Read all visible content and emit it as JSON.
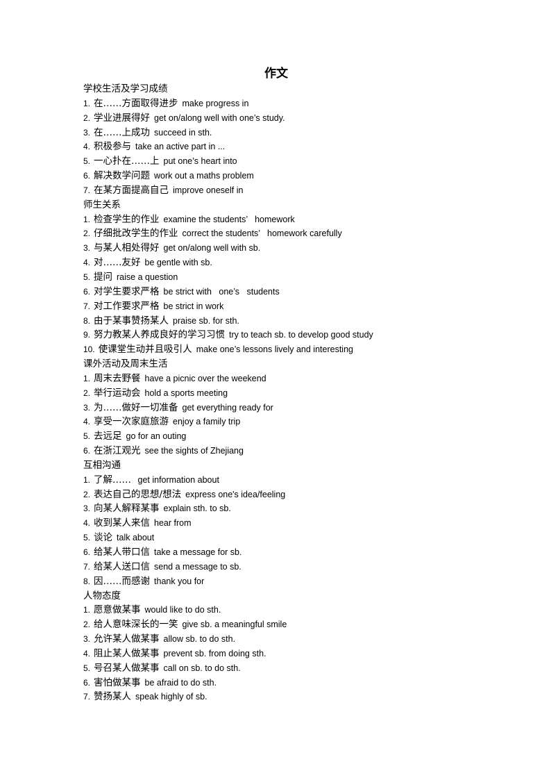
{
  "document": {
    "title": "作文",
    "sections": [
      {
        "heading": "学校生活及学习成绩",
        "items": [
          {
            "num": "1.",
            "zh": "在……方面取得进步",
            "en": "make progress in"
          },
          {
            "num": "2.",
            "zh": "学业进展得好",
            "en": "get on/along well with one’s study."
          },
          {
            "num": "3.",
            "zh": "在……上成功",
            "en": "succeed in sth."
          },
          {
            "num": "4.",
            "zh": "积极参与",
            "en": "take an active part in ..."
          },
          {
            "num": "5.",
            "zh": "一心扑在……上",
            "en": "put one’s heart into"
          },
          {
            "num": "6.",
            "zh": "解决数学问题",
            "en": "work out a maths problem"
          },
          {
            "num": "7.",
            "zh": "在某方面提高自己",
            "en": "improve oneself in"
          }
        ]
      },
      {
        "heading": "师生关系",
        "items": [
          {
            "num": "1.",
            "zh": "检查学生的作业",
            "en": "examine the students’   homework"
          },
          {
            "num": "2.",
            "zh": "仔细批改学生的作业",
            "en": "correct the students’   homework carefully"
          },
          {
            "num": "3.",
            "zh": "与某人相处得好",
            "en": "get on/along well with sb."
          },
          {
            "num": "4.",
            "zh": "对……友好",
            "en": "be gentle with sb."
          },
          {
            "num": "5.",
            "zh": "提问",
            "en": "raise a question"
          },
          {
            "num": "6.",
            "zh": "对学生要求严格",
            "en": "be strict with   one’s   students"
          },
          {
            "num": "7.",
            "zh": "对工作要求严格",
            "en": "be strict in work"
          },
          {
            "num": "8.",
            "zh": "由于某事赞扬某人",
            "en": "praise sb. for sth."
          },
          {
            "num": "9.",
            "zh": "努力教某人养成良好的学习习惯",
            "en": "try to teach sb. to develop good study"
          },
          {
            "num": "10.",
            "zh": "使课堂生动并且吸引人",
            "en": "make one’s lessons lively and interesting"
          }
        ]
      },
      {
        "heading": "课外活动及周末生活",
        "items": [
          {
            "num": "1.",
            "zh": "周末去野餐",
            "en": "have a picnic over the weekend"
          },
          {
            "num": "2.",
            "zh": "举行运动会",
            "en": "hold a sports meeting"
          },
          {
            "num": "3.",
            "zh": "为……做好一切准备",
            "en": "get everything ready for"
          },
          {
            "num": "4.",
            "zh": "享受一次家庭旅游",
            "en": "enjoy a family trip"
          },
          {
            "num": "5.",
            "zh": "去远足",
            "en": "go for an outing"
          },
          {
            "num": "6.",
            "zh": "在浙江观光",
            "en": "see the sights of Zhejiang"
          }
        ]
      },
      {
        "heading": "互相沟通",
        "items": [
          {
            "num": "1.",
            "zh": "了解……",
            "en": " get information about"
          },
          {
            "num": "2.",
            "zh": "表达自己的思想/想法",
            "en": "express one's idea/feeling"
          },
          {
            "num": "3.",
            "zh": "向某人解释某事",
            "en": "explain sth. to sb."
          },
          {
            "num": "4.",
            "zh": "收到某人来信",
            "en": "hear from"
          },
          {
            "num": "5.",
            "zh": "谈论",
            "en": "talk about"
          },
          {
            "num": "6.",
            "zh": "给某人带口信",
            "en": "take a message for sb."
          },
          {
            "num": "7.",
            "zh": "给某人送口信",
            "en": "send a message to sb."
          },
          {
            "num": "8.",
            "zh": "因……而感谢",
            "en": "thank you for"
          }
        ]
      },
      {
        "heading": "人物态度",
        "items": [
          {
            "num": "1.",
            "zh": "愿意做某事",
            "en": "would like to do sth."
          },
          {
            "num": "2.",
            "zh": "给人意味深长的一笑",
            "en": "give sb. a meaningful smile"
          },
          {
            "num": "3.",
            "zh": "允许某人做某事",
            "en": "allow sb. to do sth."
          },
          {
            "num": "4.",
            "zh": "阻止某人做某事",
            "en": "prevent sb. from doing sth."
          },
          {
            "num": "5.",
            "zh": "号召某人做某事",
            "en": "call on sb. to do sth."
          },
          {
            "num": "6.",
            "zh": "害怕做某事",
            "en": "be afraid to do sth."
          },
          {
            "num": "7.",
            "zh": "赞扬某人",
            "en": "speak highly of sb."
          }
        ]
      }
    ]
  }
}
